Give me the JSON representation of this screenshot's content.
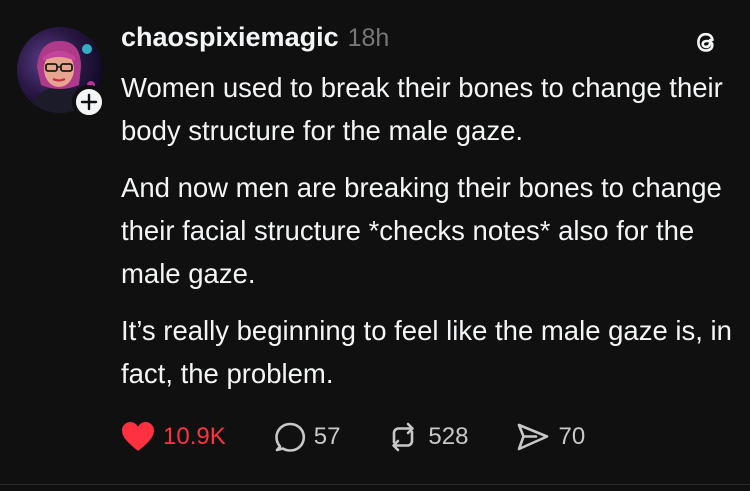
{
  "post": {
    "username": "chaospixiemagic",
    "timestamp": "18h",
    "paragraphs": [
      "Women used to break their bones to change their body structure for the male gaze.",
      "And now men are breaking their bones to change their facial structure *checks notes* also for the male gaze.",
      "It’s really beginning to feel like the male gaze is, in fact, the problem."
    ],
    "actions": {
      "likes": "10.9K",
      "replies": "57",
      "reposts": "528",
      "shares": "70"
    }
  },
  "icons": {
    "like": "heart-icon",
    "reply": "speech-bubble-icon",
    "repost": "repost-arrows-icon",
    "share": "paper-plane-icon",
    "app": "threads-logo-icon",
    "follow": "plus-icon"
  },
  "colors": {
    "background": "#101010",
    "text": "#f3f5f7",
    "muted": "#777777",
    "like": "#ff3040"
  }
}
